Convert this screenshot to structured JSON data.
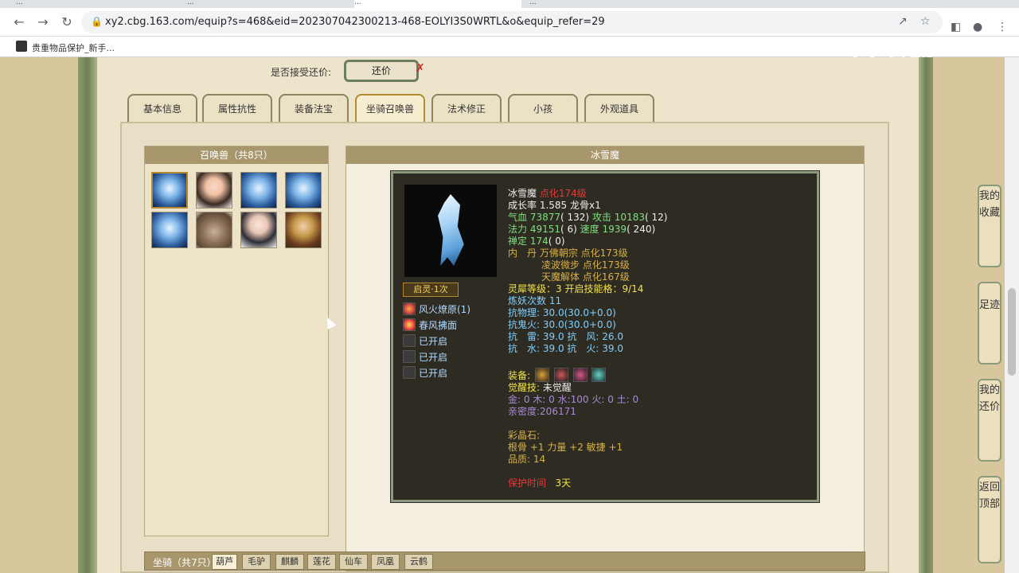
{
  "browser": {
    "tabs": [
      "...",
      "...",
      "...",
      "..."
    ],
    "url": "xy2.cbg.163.com/equip?s=468&eid=202307042300213-468-EOLYI3S0WRTL&o&equip_refer=29",
    "bookmark": "贵重物品保护_新手..."
  },
  "watermark": "CC直播",
  "offer": {
    "label": "是否接受还价:",
    "button": "还价"
  },
  "tabs": [
    "基本信息",
    "属性抗性",
    "装备法宝",
    "坐骑召唤兽",
    "法术修正",
    "小孩",
    "外观道具"
  ],
  "summon_panel": {
    "title": "召唤兽（共8只）"
  },
  "detail": {
    "title": "冰雪魔",
    "name": "冰雪魔",
    "level": "点化174级",
    "growth": "成长率 1.585 龙骨x1",
    "hp_label": "气血",
    "hp": "73877",
    "hp_add": "( 132)",
    "atk_label": "攻击",
    "atk": "10183",
    "atk_add": "( 12)",
    "mp_label": "法力",
    "mp": "49151",
    "mp_add": "( 6)",
    "spd_label": "速度",
    "spd": "1939",
    "spd_add": "( 240)",
    "def_label": "禅定",
    "def": "174",
    "def_add": "( 0)",
    "neidan_label": "内　丹",
    "neidan": [
      "万佛朝宗 点化173级",
      "凌波微步 点化173级",
      "天魔解体 点化167级"
    ],
    "qiling": "启灵·1次",
    "skills": [
      "风火燎原(1)",
      "春风拂面",
      "已开启",
      "已开启",
      "已开启"
    ],
    "lingxi": "灵犀等级：3 开启技能格：9/14",
    "lianyao": "炼妖次数 11",
    "resist": [
      "抗物理: 30.0(30.0+0.0)",
      "抗鬼火: 30.0(30.0+0.0)",
      "抗　雷: 39.0 抗　风: 26.0",
      "抗　水: 39.0 抗　火: 39.0"
    ],
    "equip_label": "装备:",
    "awaken_label": "觉醒技:",
    "awaken_value": "未觉醒",
    "elements": "金: 0 木: 0 水:100 火: 0 土: 0",
    "intimacy": "亲密度:206171",
    "gem_label": "彩晶石:",
    "gem_value": "根骨 +1 力量 +2 敏捷 +1",
    "quality": "品质:  14",
    "protect_label": "保护时间",
    "protect_value": "3天"
  },
  "mount": {
    "label": "坐骑（共7只）",
    "tabs": [
      "葫芦",
      "毛驴",
      "麒麟",
      "莲花",
      "仙车",
      "凤凰",
      "云鹤"
    ]
  },
  "sidenav": [
    "我的收藏",
    "足迹",
    "我的还价",
    "返回顶部"
  ]
}
